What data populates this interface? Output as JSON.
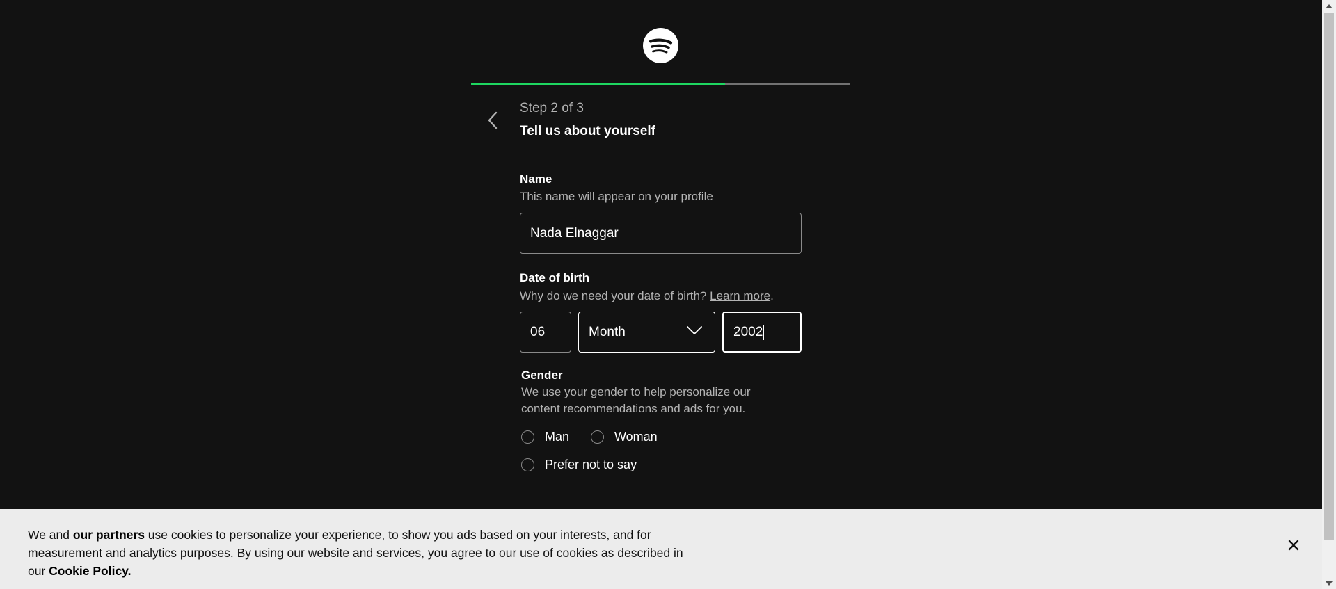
{
  "signup": {
    "progress_fraction": 0.67,
    "step_label": "Step 2 of 3",
    "step_title": "Tell us about yourself",
    "name": {
      "label": "Name",
      "help": "This name will appear on your profile",
      "value": "Nada Elnaggar"
    },
    "dob": {
      "label": "Date of birth",
      "help": "Why do we need your date of birth?",
      "learn_more": "Learn more",
      "help_suffix": ".",
      "day": "06",
      "month": "Month",
      "year": "2002"
    },
    "gender": {
      "label": "Gender",
      "help_line1": "We use your gender to help personalize our",
      "help_line2": "content recommendations and ads for you.",
      "options": [
        "Man",
        "Woman",
        "Prefer not to say"
      ]
    }
  },
  "cookie_banner": {
    "prefix": "We and ",
    "partners_link": "our partners",
    "body": " use cookies to personalize your experience, to show you ads based on your interests, and for measurement and analytics purposes. By using our website and services, you agree to our use of cookies as described in our ",
    "policy_link": "Cookie Policy."
  },
  "colors": {
    "background": "#121212",
    "accent": "#1ed760",
    "muted_text": "#b3b3b3",
    "banner_bg": "#ececec"
  },
  "icons": {
    "logo": "spotify-logo",
    "back": "chevron-left-icon",
    "select": "chevron-down-icon",
    "close": "close-icon"
  }
}
